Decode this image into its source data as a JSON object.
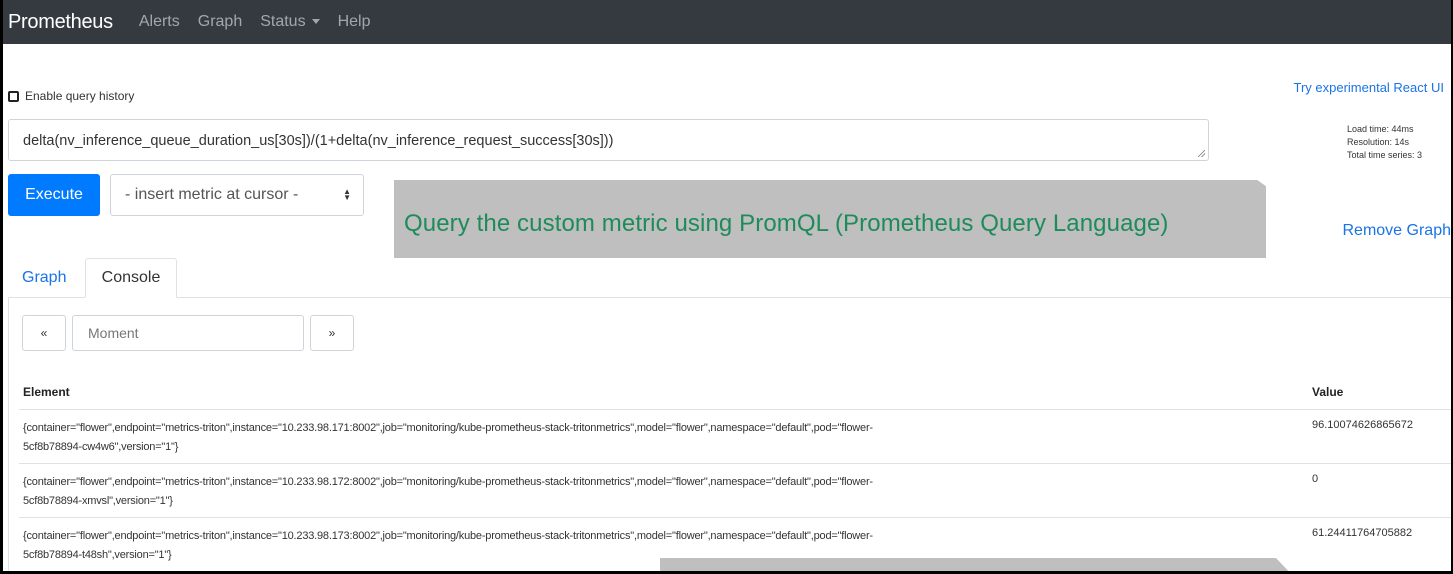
{
  "navbar": {
    "brand": "Prometheus",
    "links": [
      "Alerts",
      "Graph",
      "Status",
      "Help"
    ]
  },
  "query_history": {
    "label": "Enable query history",
    "checked": false
  },
  "react_link": "Try experimental React UI",
  "expression": "delta(nv_inference_queue_duration_us[30s])/(1+delta(nv_inference_request_success[30s]))",
  "stats": {
    "load_time": "Load time: 44ms",
    "resolution": "Resolution: 14s",
    "total_series": "Total time series: 3"
  },
  "execute_label": "Execute",
  "metric_select": "- insert metric at cursor -",
  "annotation": "Query the custom metric using PromQL (Prometheus Query Language)",
  "remove_graph": "Remove Graph",
  "tabs": [
    "Graph",
    "Console"
  ],
  "active_tab": "Console",
  "console": {
    "prev_icon": "«",
    "next_icon": "»",
    "moment_placeholder": "Moment"
  },
  "table": {
    "headers": [
      "Element",
      "Value"
    ],
    "rows": [
      {
        "element_line1": "{container=\"flower\",endpoint=\"metrics-triton\",instance=\"10.233.98.171:8002\",job=\"monitoring/kube-prometheus-stack-tritonmetrics\",model=\"flower\",namespace=\"default\",pod=\"flower-",
        "element_line2": "5cf8b78894-cw4w6\",version=\"1\"}",
        "value": "96.10074626865672"
      },
      {
        "element_line1": "{container=\"flower\",endpoint=\"metrics-triton\",instance=\"10.233.98.172:8002\",job=\"monitoring/kube-prometheus-stack-tritonmetrics\",model=\"flower\",namespace=\"default\",pod=\"flower-",
        "element_line2": "5cf8b78894-xmvsl\",version=\"1\"}",
        "value": "0"
      },
      {
        "element_line1": "{container=\"flower\",endpoint=\"metrics-triton\",instance=\"10.233.98.173:8002\",job=\"monitoring/kube-prometheus-stack-tritonmetrics\",model=\"flower\",namespace=\"default\",pod=\"flower-",
        "element_line2": "5cf8b78894-t48sh\",version=\"1\"}",
        "value": "61.24411764705882"
      }
    ]
  },
  "colors": {
    "navbar": "#343a40",
    "primary": "#007bff",
    "link": "#1a73e8",
    "annotation_bg": "#bfbfbf",
    "annotation_text": "#1e8b5a"
  }
}
